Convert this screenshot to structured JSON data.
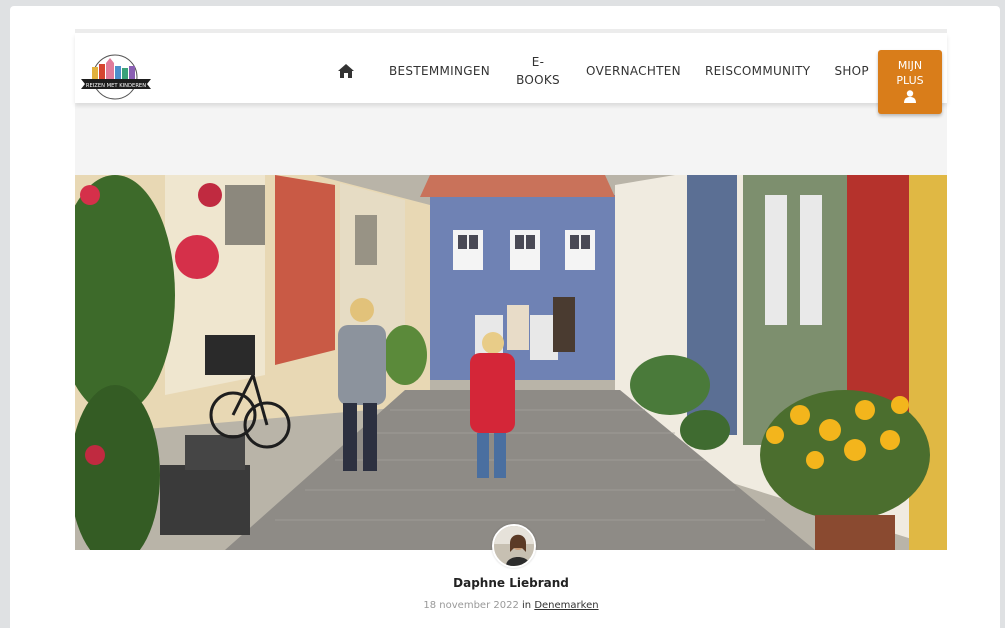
{
  "header": {
    "logo_text": "REIZEN MET KINDEREN",
    "nav": [
      {
        "label": "BESTEMMINGEN"
      },
      {
        "label": "E-BOOKS"
      },
      {
        "label": "OVERNACHTEN"
      },
      {
        "label": "REISCOMMUNITY"
      },
      {
        "label": "SHOP"
      }
    ],
    "cta": {
      "label": "MIJN PLUS",
      "icon": "user-icon"
    },
    "home_icon": "home-icon"
  },
  "colors": {
    "accent": "#d97d1a",
    "page_bg": "#dfe1e3",
    "band_bg": "#f4f4f4"
  },
  "post": {
    "author": "Daphne Liebrand",
    "date": "18 november 2022",
    "in_word": "in",
    "category": "Denemarken"
  }
}
